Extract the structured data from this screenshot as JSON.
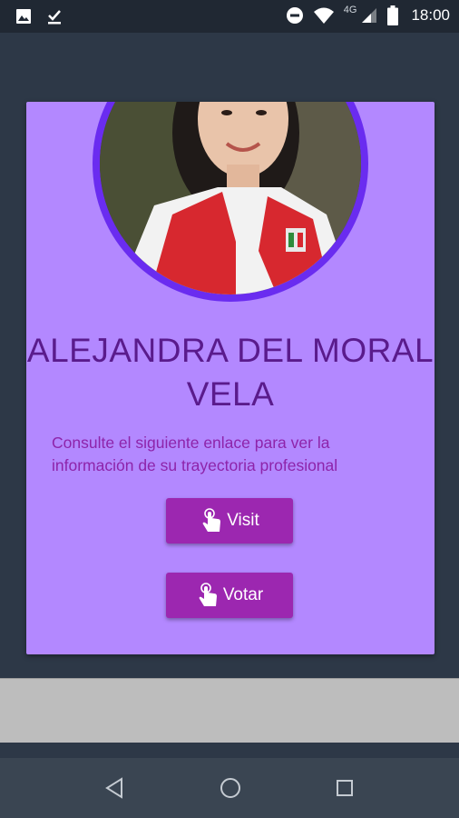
{
  "status_bar": {
    "time": "18:00",
    "network": "4G",
    "icons": [
      "image-icon",
      "download-done-icon",
      "do-not-disturb-icon",
      "wifi-icon",
      "signal-icon",
      "battery-icon"
    ]
  },
  "card": {
    "name": "ALEJANDRA DEL MORAL VELA",
    "description": "Consulte el siguiente enlace para ver la información de su trayectoria profesional",
    "buttons": {
      "visit_label": "Visit",
      "votar_label": "Votar"
    }
  },
  "nav_bar": {
    "icons": [
      "back-icon",
      "home-icon",
      "recents-icon"
    ]
  },
  "colors": {
    "card_bg": "#b388ff",
    "ring": "#6a2cf0",
    "name_text": "#5a1b8c",
    "desc_text": "#8e24aa",
    "button_bg": "#9c27b0"
  }
}
